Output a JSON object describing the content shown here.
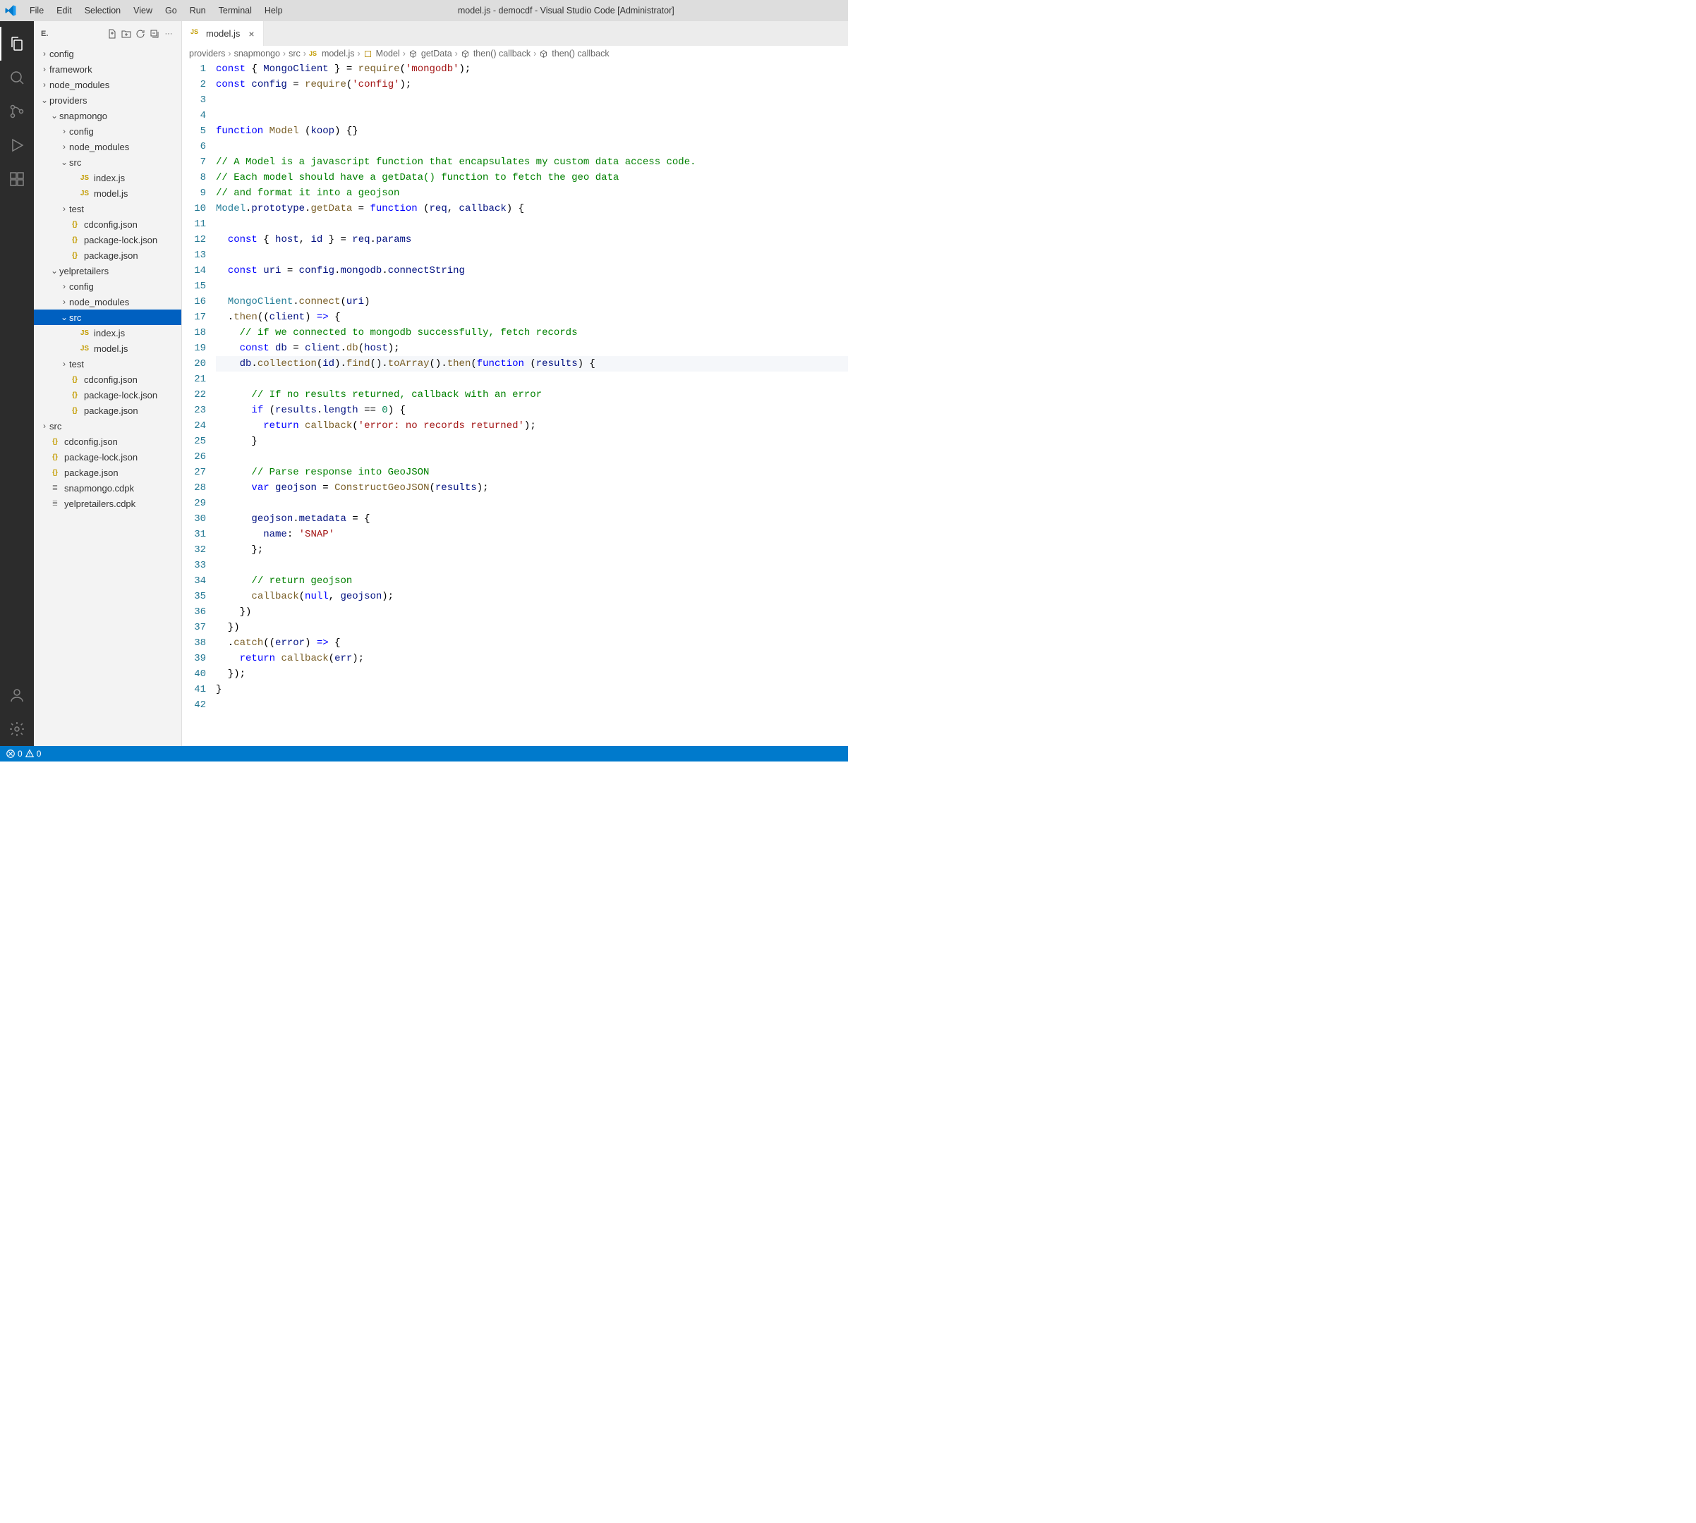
{
  "titlebar": {
    "menus": [
      "File",
      "Edit",
      "Selection",
      "View",
      "Go",
      "Run",
      "Terminal",
      "Help"
    ],
    "title": "model.js - democdf - Visual Studio Code [Administrator]"
  },
  "activitybar": {
    "items": [
      {
        "name": "explorer",
        "active": true
      },
      {
        "name": "search",
        "active": false
      },
      {
        "name": "source-control",
        "active": false
      },
      {
        "name": "run-debug",
        "active": false
      },
      {
        "name": "extensions",
        "active": false
      }
    ],
    "bottom": [
      {
        "name": "accounts"
      },
      {
        "name": "settings"
      }
    ]
  },
  "sidebar": {
    "header_letter": "E.",
    "tree": [
      {
        "depth": 0,
        "twisty": ">",
        "icon": "",
        "label": "config"
      },
      {
        "depth": 0,
        "twisty": ">",
        "icon": "",
        "label": "framework"
      },
      {
        "depth": 0,
        "twisty": ">",
        "icon": "",
        "label": "node_modules"
      },
      {
        "depth": 0,
        "twisty": "v",
        "icon": "",
        "label": "providers"
      },
      {
        "depth": 1,
        "twisty": "v",
        "icon": "",
        "label": "snapmongo"
      },
      {
        "depth": 2,
        "twisty": ">",
        "icon": "",
        "label": "config"
      },
      {
        "depth": 2,
        "twisty": ">",
        "icon": "",
        "label": "node_modules"
      },
      {
        "depth": 2,
        "twisty": "v",
        "icon": "",
        "label": "src"
      },
      {
        "depth": 3,
        "twisty": "",
        "icon": "js",
        "label": "index.js"
      },
      {
        "depth": 3,
        "twisty": "",
        "icon": "js",
        "label": "model.js"
      },
      {
        "depth": 2,
        "twisty": ">",
        "icon": "",
        "label": "test"
      },
      {
        "depth": 2,
        "twisty": "",
        "icon": "json",
        "label": "cdconfig.json"
      },
      {
        "depth": 2,
        "twisty": "",
        "icon": "json",
        "label": "package-lock.json"
      },
      {
        "depth": 2,
        "twisty": "",
        "icon": "json",
        "label": "package.json"
      },
      {
        "depth": 1,
        "twisty": "v",
        "icon": "",
        "label": "yelpretailers"
      },
      {
        "depth": 2,
        "twisty": ">",
        "icon": "",
        "label": "config"
      },
      {
        "depth": 2,
        "twisty": ">",
        "icon": "",
        "label": "node_modules"
      },
      {
        "depth": 2,
        "twisty": "v",
        "icon": "",
        "label": "src",
        "selected": true
      },
      {
        "depth": 3,
        "twisty": "",
        "icon": "js",
        "label": "index.js"
      },
      {
        "depth": 3,
        "twisty": "",
        "icon": "js",
        "label": "model.js"
      },
      {
        "depth": 2,
        "twisty": ">",
        "icon": "",
        "label": "test"
      },
      {
        "depth": 2,
        "twisty": "",
        "icon": "json",
        "label": "cdconfig.json"
      },
      {
        "depth": 2,
        "twisty": "",
        "icon": "json",
        "label": "package-lock.json"
      },
      {
        "depth": 2,
        "twisty": "",
        "icon": "json",
        "label": "package.json"
      },
      {
        "depth": 0,
        "twisty": ">",
        "icon": "",
        "label": "src"
      },
      {
        "depth": 0,
        "twisty": "",
        "icon": "json",
        "label": "cdconfig.json"
      },
      {
        "depth": 0,
        "twisty": "",
        "icon": "json",
        "label": "package-lock.json"
      },
      {
        "depth": 0,
        "twisty": "",
        "icon": "json",
        "label": "package.json"
      },
      {
        "depth": 0,
        "twisty": "",
        "icon": "lines",
        "label": "snapmongo.cdpk"
      },
      {
        "depth": 0,
        "twisty": "",
        "icon": "lines",
        "label": "yelpretailers.cdpk"
      }
    ]
  },
  "tab": {
    "label": "model.js"
  },
  "breadcrumbs": [
    {
      "text": "providers"
    },
    {
      "text": "snapmongo"
    },
    {
      "text": "src"
    },
    {
      "icon": "js",
      "text": "model.js"
    },
    {
      "icon": "class",
      "text": "Model"
    },
    {
      "icon": "cube",
      "text": "getData"
    },
    {
      "icon": "cube",
      "text": "then() callback"
    },
    {
      "icon": "cube",
      "text": "then() callback"
    }
  ],
  "code": {
    "first_line": 1,
    "highlight": 20,
    "lines": [
      [
        [
          "kw",
          "const"
        ],
        [
          "op",
          " { "
        ],
        [
          "var",
          "MongoClient"
        ],
        [
          "op",
          " } = "
        ],
        [
          "fn",
          "require"
        ],
        [
          "op",
          "("
        ],
        [
          "str",
          "'mongodb'"
        ],
        [
          "op",
          ");"
        ]
      ],
      [
        [
          "kw",
          "const"
        ],
        [
          "op",
          " "
        ],
        [
          "var",
          "config"
        ],
        [
          "op",
          " = "
        ],
        [
          "fn",
          "require"
        ],
        [
          "op",
          "("
        ],
        [
          "str",
          "'config'"
        ],
        [
          "op",
          ");"
        ]
      ],
      [],
      [],
      [
        [
          "kw",
          "function"
        ],
        [
          "op",
          " "
        ],
        [
          "fn",
          "Model"
        ],
        [
          "op",
          " ("
        ],
        [
          "var",
          "koop"
        ],
        [
          "op",
          ") {}"
        ]
      ],
      [],
      [
        [
          "com",
          "// A Model is a javascript function that encapsulates my custom data access code."
        ]
      ],
      [
        [
          "com",
          "// Each model should have a getData() function to fetch the geo data"
        ]
      ],
      [
        [
          "com",
          "// and format it into a geojson"
        ]
      ],
      [
        [
          "cls",
          "Model"
        ],
        [
          "op",
          "."
        ],
        [
          "var",
          "prototype"
        ],
        [
          "op",
          "."
        ],
        [
          "fn",
          "getData"
        ],
        [
          "op",
          " = "
        ],
        [
          "kw",
          "function"
        ],
        [
          "op",
          " ("
        ],
        [
          "var",
          "req"
        ],
        [
          "op",
          ", "
        ],
        [
          "var",
          "callback"
        ],
        [
          "op",
          ") {"
        ]
      ],
      [],
      [
        [
          "op",
          "  "
        ],
        [
          "kw",
          "const"
        ],
        [
          "op",
          " { "
        ],
        [
          "var",
          "host"
        ],
        [
          "op",
          ", "
        ],
        [
          "var",
          "id"
        ],
        [
          "op",
          " } = "
        ],
        [
          "var",
          "req"
        ],
        [
          "op",
          "."
        ],
        [
          "var",
          "params"
        ]
      ],
      [],
      [
        [
          "op",
          "  "
        ],
        [
          "kw",
          "const"
        ],
        [
          "op",
          " "
        ],
        [
          "var",
          "uri"
        ],
        [
          "op",
          " = "
        ],
        [
          "var",
          "config"
        ],
        [
          "op",
          "."
        ],
        [
          "var",
          "mongodb"
        ],
        [
          "op",
          "."
        ],
        [
          "var",
          "connectString"
        ]
      ],
      [],
      [
        [
          "op",
          "  "
        ],
        [
          "cls",
          "MongoClient"
        ],
        [
          "op",
          "."
        ],
        [
          "fn",
          "connect"
        ],
        [
          "op",
          "("
        ],
        [
          "var",
          "uri"
        ],
        [
          "op",
          ")"
        ]
      ],
      [
        [
          "op",
          "  ."
        ],
        [
          "fn",
          "then"
        ],
        [
          "op",
          "(("
        ],
        [
          "var",
          "client"
        ],
        [
          "op",
          ") "
        ],
        [
          "kw",
          "=>"
        ],
        [
          "op",
          " {"
        ]
      ],
      [
        [
          "op",
          "    "
        ],
        [
          "com",
          "// if we connected to mongodb successfully, fetch records"
        ]
      ],
      [
        [
          "op",
          "    "
        ],
        [
          "kw",
          "const"
        ],
        [
          "op",
          " "
        ],
        [
          "var",
          "db"
        ],
        [
          "op",
          " = "
        ],
        [
          "var",
          "client"
        ],
        [
          "op",
          "."
        ],
        [
          "fn",
          "db"
        ],
        [
          "op",
          "("
        ],
        [
          "var",
          "host"
        ],
        [
          "op",
          ");"
        ]
      ],
      [
        [
          "op",
          "    "
        ],
        [
          "var",
          "db"
        ],
        [
          "op",
          "."
        ],
        [
          "fn",
          "collection"
        ],
        [
          "op",
          "("
        ],
        [
          "var",
          "id"
        ],
        [
          "op",
          ")."
        ],
        [
          "fn",
          "find"
        ],
        [
          "op",
          "()."
        ],
        [
          "fn",
          "toArray"
        ],
        [
          "op",
          "()."
        ],
        [
          "fn",
          "then"
        ],
        [
          "op",
          "("
        ],
        [
          "kw",
          "function"
        ],
        [
          "op",
          " ("
        ],
        [
          "var",
          "results"
        ],
        [
          "op",
          ") {"
        ]
      ],
      [],
      [
        [
          "op",
          "      "
        ],
        [
          "com",
          "// If no results returned, callback with an error"
        ]
      ],
      [
        [
          "op",
          "      "
        ],
        [
          "kw",
          "if"
        ],
        [
          "op",
          " ("
        ],
        [
          "var",
          "results"
        ],
        [
          "op",
          "."
        ],
        [
          "var",
          "length"
        ],
        [
          "op",
          " == "
        ],
        [
          "num",
          "0"
        ],
        [
          "op",
          ") {"
        ]
      ],
      [
        [
          "op",
          "        "
        ],
        [
          "kw",
          "return"
        ],
        [
          "op",
          " "
        ],
        [
          "fn",
          "callback"
        ],
        [
          "op",
          "("
        ],
        [
          "str",
          "'error: no records returned'"
        ],
        [
          "op",
          ");"
        ]
      ],
      [
        [
          "op",
          "      }"
        ]
      ],
      [],
      [
        [
          "op",
          "      "
        ],
        [
          "com",
          "// Parse response into GeoJSON"
        ]
      ],
      [
        [
          "op",
          "      "
        ],
        [
          "kw",
          "var"
        ],
        [
          "op",
          " "
        ],
        [
          "var",
          "geojson"
        ],
        [
          "op",
          " = "
        ],
        [
          "fn",
          "ConstructGeoJSON"
        ],
        [
          "op",
          "("
        ],
        [
          "var",
          "results"
        ],
        [
          "op",
          ");"
        ]
      ],
      [],
      [
        [
          "op",
          "      "
        ],
        [
          "var",
          "geojson"
        ],
        [
          "op",
          "."
        ],
        [
          "var",
          "metadata"
        ],
        [
          "op",
          " = {"
        ]
      ],
      [
        [
          "op",
          "        "
        ],
        [
          "prop",
          "name"
        ],
        [
          "op",
          ": "
        ],
        [
          "str",
          "'SNAP'"
        ]
      ],
      [
        [
          "op",
          "      };"
        ]
      ],
      [],
      [
        [
          "op",
          "      "
        ],
        [
          "com",
          "// return geojson"
        ]
      ],
      [
        [
          "op",
          "      "
        ],
        [
          "fn",
          "callback"
        ],
        [
          "op",
          "("
        ],
        [
          "kw",
          "null"
        ],
        [
          "op",
          ", "
        ],
        [
          "var",
          "geojson"
        ],
        [
          "op",
          ");"
        ]
      ],
      [
        [
          "op",
          "    })"
        ]
      ],
      [
        [
          "op",
          "  })"
        ]
      ],
      [
        [
          "op",
          "  ."
        ],
        [
          "fn",
          "catch"
        ],
        [
          "op",
          "(("
        ],
        [
          "var",
          "error"
        ],
        [
          "op",
          ") "
        ],
        [
          "kw",
          "=>"
        ],
        [
          "op",
          " {"
        ]
      ],
      [
        [
          "op",
          "    "
        ],
        [
          "kw",
          "return"
        ],
        [
          "op",
          " "
        ],
        [
          "fn",
          "callback"
        ],
        [
          "op",
          "("
        ],
        [
          "var",
          "err"
        ],
        [
          "op",
          ");"
        ]
      ],
      [
        [
          "op",
          "  });"
        ]
      ],
      [
        [
          "op",
          "}"
        ]
      ],
      []
    ]
  },
  "statusbar": {
    "errors": "0",
    "warnings": "0"
  }
}
